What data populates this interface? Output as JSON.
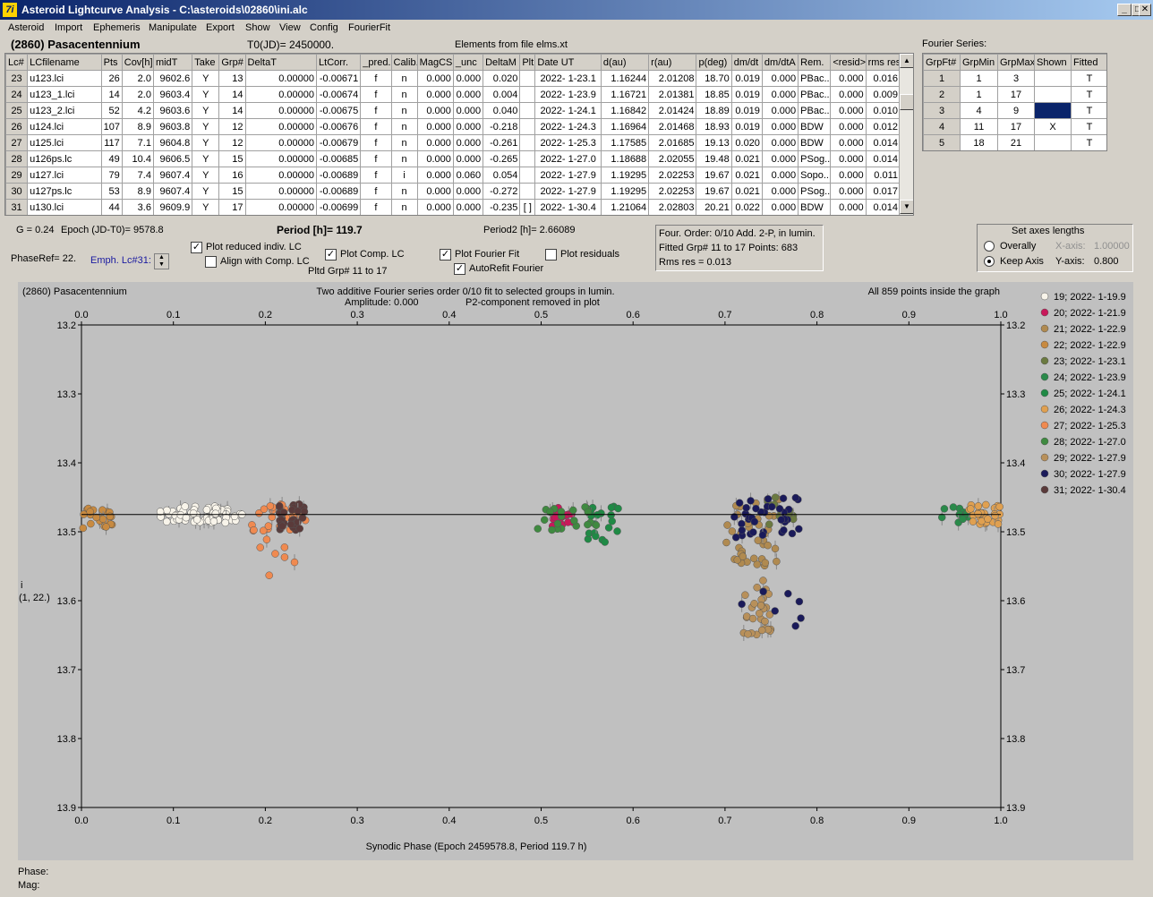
{
  "window": {
    "title": "Asteroid Lightcurve Analysis - C:\\asteroids\\02860\\ini.alc",
    "app_icon": "7i"
  },
  "menu": [
    "Asteroid",
    "Import",
    "Ephemeris",
    "Manipulate",
    "Export",
    "Show",
    "View",
    "Config",
    "FourierFit"
  ],
  "header": {
    "object": "(2860) Pasacentennium",
    "t0": "T0(JD)= 2450000.",
    "elements": "Elements from file elms.xt",
    "fourier_series_label": "Fourier Series:"
  },
  "lc_table": {
    "columns": [
      "Lc#",
      "LCfilename",
      "Pts",
      "Cov[h]",
      "midT",
      "Take",
      "Grp#",
      "DeltaT",
      "LtCorr.",
      "_pred.",
      "Calib.",
      "MagCS",
      "_unc",
      "DeltaM",
      "Plt",
      "Date UT",
      "d(au)",
      "r(au)",
      "p(deg)",
      "dm/dt",
      "dm/dtA",
      "Rem.",
      "<resid>",
      "rms res"
    ],
    "rows": [
      [
        "23",
        "u123.lci",
        "26",
        "2.0",
        "9602.6",
        "Y",
        "13",
        "0.00000",
        "-0.00671",
        "f",
        "n",
        "0.000",
        "0.000",
        "0.020",
        "",
        "2022- 1-23.1",
        "1.16244",
        "2.01208",
        "18.70",
        "0.019",
        "0.000",
        "PBac..",
        "0.000",
        "0.016"
      ],
      [
        "24",
        "u123_1.lci",
        "14",
        "2.0",
        "9603.4",
        "Y",
        "14",
        "0.00000",
        "-0.00674",
        "f",
        "n",
        "0.000",
        "0.000",
        "0.004",
        "",
        "2022- 1-23.9",
        "1.16721",
        "2.01381",
        "18.85",
        "0.019",
        "0.000",
        "PBac..",
        "0.000",
        "0.009"
      ],
      [
        "25",
        "u123_2.lci",
        "52",
        "4.2",
        "9603.6",
        "Y",
        "14",
        "0.00000",
        "-0.00675",
        "f",
        "n",
        "0.000",
        "0.000",
        "0.040",
        "",
        "2022- 1-24.1",
        "1.16842",
        "2.01424",
        "18.89",
        "0.019",
        "0.000",
        "PBac..",
        "0.000",
        "0.010"
      ],
      [
        "26",
        "u124.lci",
        "107",
        "8.9",
        "9603.8",
        "Y",
        "12",
        "0.00000",
        "-0.00676",
        "f",
        "n",
        "0.000",
        "0.000",
        "-0.218",
        "",
        "2022- 1-24.3",
        "1.16964",
        "2.01468",
        "18.93",
        "0.019",
        "0.000",
        "BDW",
        "0.000",
        "0.012"
      ],
      [
        "27",
        "u125.lci",
        "117",
        "7.1",
        "9604.8",
        "Y",
        "12",
        "0.00000",
        "-0.00679",
        "f",
        "n",
        "0.000",
        "0.000",
        "-0.261",
        "",
        "2022- 1-25.3",
        "1.17585",
        "2.01685",
        "19.13",
        "0.020",
        "0.000",
        "BDW",
        "0.000",
        "0.014"
      ],
      [
        "28",
        "u126ps.lc",
        "49",
        "10.4",
        "9606.5",
        "Y",
        "15",
        "0.00000",
        "-0.00685",
        "f",
        "n",
        "0.000",
        "0.000",
        "-0.265",
        "",
        "2022- 1-27.0",
        "1.18688",
        "2.02055",
        "19.48",
        "0.021",
        "0.000",
        "PSog..",
        "0.000",
        "0.014"
      ],
      [
        "29",
        "u127.lci",
        "79",
        "7.4",
        "9607.4",
        "Y",
        "16",
        "0.00000",
        "-0.00689",
        "f",
        "i",
        "0.000",
        "0.060",
        "0.054",
        "",
        "2022- 1-27.9",
        "1.19295",
        "2.02253",
        "19.67",
        "0.021",
        "0.000",
        "Sopo..",
        "0.000",
        "0.011"
      ],
      [
        "30",
        "u127ps.lc",
        "53",
        "8.9",
        "9607.4",
        "Y",
        "15",
        "0.00000",
        "-0.00689",
        "f",
        "n",
        "0.000",
        "0.000",
        "-0.272",
        "",
        "2022- 1-27.9",
        "1.19295",
        "2.02253",
        "19.67",
        "0.021",
        "0.000",
        "PSog..",
        "0.000",
        "0.017"
      ],
      [
        "31",
        "u130.lci",
        "44",
        "3.6",
        "9609.9",
        "Y",
        "17",
        "0.00000",
        "-0.00699",
        "f",
        "n",
        "0.000",
        "0.000",
        "-0.235",
        "[ ]",
        "2022- 1-30.4",
        "1.21064",
        "2.02803",
        "20.21",
        "0.022",
        "0.000",
        "BDW",
        "0.000",
        "0.014"
      ]
    ]
  },
  "fourier_table": {
    "columns": [
      "GrpFt#",
      "GrpMin",
      "GrpMax",
      "Shown",
      "Fitted"
    ],
    "rows": [
      [
        "1",
        "1",
        "3",
        "",
        "T"
      ],
      [
        "2",
        "1",
        "17",
        "",
        "T"
      ],
      [
        "3",
        "4",
        "9",
        "",
        "T"
      ],
      [
        "4",
        "11",
        "17",
        "X",
        "T"
      ],
      [
        "5",
        "18",
        "21",
        "",
        "T"
      ]
    ]
  },
  "controls": {
    "g": "G = 0.24",
    "epoch": "Epoch (JD-T0)= 9578.8",
    "period": "Period [h]= 119.7",
    "period2": "Period2 [h]= 2.66089",
    "phaseref": "PhaseRef= 22.",
    "emph_lc": "Emph. Lc#31:",
    "plot_reduced": "Plot reduced indiv. LC",
    "align_comp": "Align with Comp. LC",
    "plot_comp": "Plot Comp. LC",
    "pltd_grp": "Pltd Grp#  11 to   17",
    "plot_fourier": "Plot Fourier Fit",
    "autorefit": "AutoRefit Fourier",
    "plot_residuals": "Plot residuals",
    "fourier_info_1": "Four. Order:  0/10   Add. 2-P, in lumin.",
    "fourier_info_2": "Fitted Grp# 11 to 17 Points: 683",
    "fourier_info_3": "Rms res     = 0.013",
    "axes_title": "Set axes lengths",
    "overally": "Overally",
    "keep_axis": "Keep Axis",
    "x_axis_label": "X-axis:",
    "x_axis_value": "1.00000",
    "y_axis_label": "Y-axis:",
    "y_axis_value": "0.800"
  },
  "plot": {
    "object": "(2860) Pasacentennium",
    "title_line1": "Two additive Fourier series order 0/10 fit to selected groups in lumin.",
    "title_line2": "Amplitude: 0.000",
    "title_line3": "P2-component removed in plot",
    "points_info": "All 859 points inside the graph",
    "xlabel": "Synodic Phase (Epoch 2459578.8, Period 119.7 h)",
    "ylabel_1": "i",
    "ylabel_2": "(1, 22.)",
    "phase_label": "Phase:",
    "mag_label": "Mag:"
  },
  "chart_data": {
    "type": "scatter",
    "xlim": [
      0.0,
      1.0
    ],
    "ylim": [
      13.9,
      13.2
    ],
    "xticks": [
      "0.0",
      "0.1",
      "0.2",
      "0.3",
      "0.4",
      "0.5",
      "0.6",
      "0.7",
      "0.8",
      "0.9",
      "1.0"
    ],
    "yticks": [
      "13.2",
      "13.3",
      "13.4",
      "13.5",
      "13.6",
      "13.7",
      "13.8",
      "13.9"
    ],
    "fit_line_y": 13.475,
    "series": [
      {
        "name": "19; 2022- 1-19.9",
        "color": "#f8f4ea",
        "x_range": [
          0.085,
          0.175
        ],
        "y_center": 13.475,
        "spread": 0.012,
        "count": 70
      },
      {
        "name": "20; 2022- 1-21.9",
        "color": "#c8185a",
        "x_range": [
          0.51,
          0.535
        ],
        "y_center": 13.48,
        "spread": 0.015,
        "count": 18
      },
      {
        "name": "21; 2022- 1-22.9",
        "color": "#b08a50",
        "x_range": [
          0.7,
          0.76
        ],
        "y_center": 13.5,
        "spread": 0.05,
        "count": 40
      },
      {
        "name": "22; 2022- 1-22.9",
        "color": "#c88a40",
        "x_range": [
          0.0,
          0.04
        ],
        "y_center": 13.48,
        "spread": 0.015,
        "count": 22
      },
      {
        "name": "23; 2022- 1-23.1",
        "color": "#6b7a40",
        "x_range": [
          0.745,
          0.775
        ],
        "y_center": 13.47,
        "spread": 0.02,
        "count": 12
      },
      {
        "name": "24; 2022- 1-23.9",
        "color": "#2a8a4a",
        "x_range": [
          0.935,
          0.965
        ],
        "y_center": 13.475,
        "spread": 0.012,
        "count": 12
      },
      {
        "name": "25; 2022- 1-24.1",
        "color": "#1f8a45",
        "x_range": [
          0.55,
          0.59
        ],
        "y_center": 13.49,
        "spread": 0.03,
        "count": 20
      },
      {
        "name": "26; 2022- 1-24.3",
        "color": "#e0a050",
        "x_range": [
          0.965,
          1.0
        ],
        "y_center": 13.475,
        "spread": 0.015,
        "count": 30
      },
      {
        "name": "27; 2022- 1-25.3",
        "color": "#f08a50",
        "x_range": [
          0.185,
          0.245
        ],
        "y_center": 13.48,
        "spread": 0.02,
        "count": 40
      },
      {
        "name": "28; 2022- 1-27.0",
        "color": "#3f8a40",
        "x_range": [
          0.495,
          0.56
        ],
        "y_center": 13.48,
        "spread": 0.02,
        "count": 20
      },
      {
        "name": "29; 2022- 1-27.9",
        "color": "#b8905a",
        "x_range": [
          0.72,
          0.75
        ],
        "y_center": 13.61,
        "spread": 0.04,
        "count": 30
      },
      {
        "name": "30; 2022- 1-27.9",
        "color": "#1a1a5a",
        "x_range": [
          0.71,
          0.785
        ],
        "y_center": 13.48,
        "spread": 0.03,
        "count": 45
      },
      {
        "name": "31; 2022- 1-30.4",
        "color": "#5a3a3a",
        "x_range": [
          0.215,
          0.245
        ],
        "y_center": 13.48,
        "spread": 0.02,
        "count": 35
      }
    ]
  }
}
